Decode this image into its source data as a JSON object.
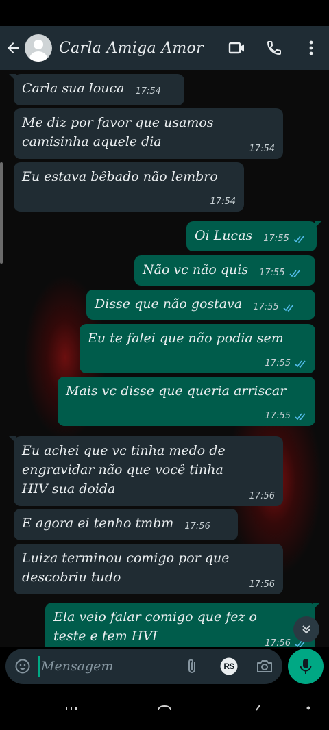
{
  "header": {
    "contact_name": "Carla Amiga Amor",
    "icons": [
      "back-arrow-icon",
      "avatar-default-icon",
      "video-call-icon",
      "voice-call-icon",
      "more-options-icon"
    ]
  },
  "messages": [
    {
      "direction": "in",
      "text": "Carla sua louca",
      "time": "17:54"
    },
    {
      "direction": "in",
      "text": "Me diz por favor que usamos camisinha aquele dia",
      "line1": "Me diz por favor que usamos",
      "line2": "camisinha aquele dia",
      "time": "17:54"
    },
    {
      "direction": "in",
      "text": "Eu estava bêbado não lembro",
      "time": "17:54"
    },
    {
      "direction": "out",
      "text": "Oi Lucas",
      "time": "17:55",
      "status": "read"
    },
    {
      "direction": "out",
      "text": "Não vc não quis",
      "time": "17:55",
      "status": "read"
    },
    {
      "direction": "out",
      "text": "Disse que não gostava",
      "time": "17:55",
      "status": "read"
    },
    {
      "direction": "out",
      "text": "Eu te falei que não podia sem",
      "time": "17:55",
      "status": "read"
    },
    {
      "direction": "out",
      "text": "Mais vc disse que queria arriscar",
      "time": "17:55",
      "status": "read"
    },
    {
      "direction": "in",
      "text": "Eu achei que vc  tinha medo de engravidar não que você tinha HIV sua doida",
      "line1": "Eu achei que vc  tinha medo de",
      "line2": "engravidar não que você tinha",
      "line3": "HIV sua doida",
      "time": "17:56"
    },
    {
      "direction": "in",
      "text": "E agora ei tenho tmbm",
      "time": "17:56"
    },
    {
      "direction": "in",
      "text": "Luiza terminou comigo por que descobriu tudo",
      "line1": "Luiza terminou comigo por que",
      "line2": "descobriu tudo",
      "time": "17:56"
    },
    {
      "direction": "out",
      "text": "Ela veio falar  comigo que fez o teste e tem HVI",
      "line1": "Ela veio falar  comigo que fez o",
      "line2": "teste e tem HVI",
      "time": "17:56",
      "status": "read"
    }
  ],
  "composer": {
    "placeholder": "Mensagem",
    "icons": [
      "emoji-icon",
      "attach-icon",
      "payment-icon",
      "camera-icon",
      "mic-icon"
    ],
    "payment_label": "R$"
  },
  "colors": {
    "header_bg": "#1f2c34",
    "incoming_bubble": "#202c33",
    "outgoing_bubble": "#005c4b",
    "accent": "#00a884",
    "read_tick": "#53bdeb"
  }
}
